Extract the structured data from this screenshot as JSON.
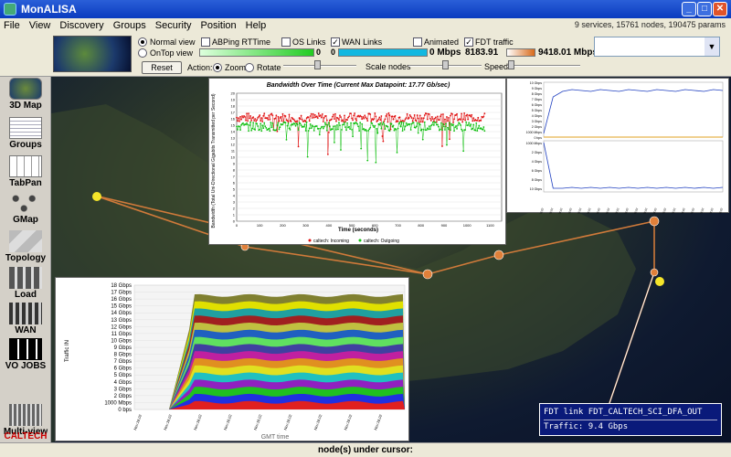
{
  "window": {
    "title": "MonALISA"
  },
  "menu": [
    "File",
    "View",
    "Discovery",
    "Groups",
    "Security",
    "Position",
    "Help"
  ],
  "status_summary": "9 services, 15761 nodes, 190475 params",
  "toolbar": {
    "normal_view": "Normal view",
    "ontop_view": "OnTop view",
    "reset": "Reset",
    "abping": "ABPing RTTime",
    "os_links": "OS Links",
    "wan_links": "WAN Links",
    "animated": "Animated",
    "fdt_traffic": "FDT traffic",
    "abping_val": "0",
    "os_val": "0",
    "wan_val": "0",
    "wan_rate": "0 Mbps",
    "fdt_min": "8183.91",
    "fdt_max": "9418.01 Mbps",
    "action": "Action:",
    "zoom": "Zoom",
    "rotate": "Rotate",
    "scale_nodes": "Scale nodes",
    "speed": "Speed",
    "wan_checked": "✓",
    "fdt_checked": "✓",
    "colors": {
      "abping": "#22cc22",
      "wan": "#12b8e0",
      "fdt_start": "#ffffff",
      "fdt_end": "#d86a1a"
    }
  },
  "sidebar": [
    {
      "label": "3D Map",
      "icon": "globe-icon"
    },
    {
      "label": "Groups",
      "icon": "groups-icon"
    },
    {
      "label": "TabPan",
      "icon": "table-icon"
    },
    {
      "label": "GMap",
      "icon": "graph-icon"
    },
    {
      "label": "Topology",
      "icon": "topology-icon"
    },
    {
      "label": "Load",
      "icon": "load-icon"
    },
    {
      "label": "WAN",
      "icon": "wan-icon"
    },
    {
      "label": "VO JOBS",
      "icon": "jobs-icon"
    },
    {
      "label": "Multi-view",
      "icon": "multiview-icon"
    }
  ],
  "logo": "CALTECH",
  "statusbar": "node(s) under cursor:",
  "tooltip": {
    "line1": "FDT link FDT_CALTECH_SCI_DFA_OUT",
    "line2": "Traffic: 9.4 Gbps"
  },
  "bw_title": "Bandwidth Over Time (Current Max Datapoint: 17.77 Gb/sec)",
  "bw_ylabel": "Bandwidth (Total Uni-Directional Gigabits Transmitted per Second)",
  "bw_xlabel": "Time (seconds)",
  "bw_legend": [
    "caltech: Incoming",
    "caltech: Outgoing"
  ],
  "stack_ylabel": "Traffic IN",
  "stack_xlabel": "GMT time",
  "chart_data": [
    {
      "type": "scatter",
      "title": "Bandwidth Over Time (Current Max Datapoint: 17.77 Gb/sec)",
      "xlabel": "Time (seconds)",
      "ylabel": "Bandwidth (Total Uni-Directional Gigabits Transmitted per Second)",
      "xticks": [
        0,
        100,
        200,
        300,
        400,
        500,
        600,
        700,
        800,
        900,
        1000,
        1100
      ],
      "yticks": [
        0,
        1,
        2,
        3,
        4,
        5,
        6,
        7,
        8,
        9,
        10,
        11,
        12,
        13,
        14,
        15,
        16,
        17,
        18,
        19,
        20
      ],
      "series": [
        {
          "name": "caltech: Incoming",
          "color": "#e01010",
          "typical": 16.2
        },
        {
          "name": "caltech: Outgoing",
          "color": "#10c010",
          "typical": 14.8
        }
      ]
    },
    {
      "type": "area",
      "ylabel": "Traffic IN",
      "xlabel": "GMT time",
      "yticks": [
        "0 bps",
        "1000 Mbps",
        "2 Gbps",
        "3 Gbps",
        "4 Gbps",
        "5 Gbps",
        "6 Gbps",
        "7 Gbps",
        "8 Gbps",
        "9 Gbps",
        "10 Gbps",
        "11 Gbps",
        "12 Gbps",
        "13 Gbps",
        "14 Gbps",
        "15 Gbps",
        "16 Gbps",
        "17 Gbps",
        "18 Gbps"
      ],
      "layers": 16,
      "peak_gbps": 16.5,
      "colors": [
        "#e02020",
        "#2030e0",
        "#20c020",
        "#9020c0",
        "#20c0c0",
        "#e0e020",
        "#e09020",
        "#c020a0",
        "#4040a0",
        "#60e060",
        "#2060c0",
        "#c0c040",
        "#a02020",
        "#20a0a0",
        "#e0e000",
        "#808030"
      ]
    },
    {
      "type": "line",
      "panels": [
        "Traffic IN",
        "Traffic OUT"
      ],
      "yticks_top": [
        "10 Gbps",
        "9 Gbps",
        "8 Gbps",
        "7 Gbps",
        "6 Gbps",
        "5 Gbps",
        "4 Gbps",
        "3 Gbps",
        "2 Gbps",
        "1000 Mbps",
        "0 bps"
      ],
      "yticks_bottom": [
        "1000 Mbps",
        "2 Gbps",
        "4 Gbps",
        "6 Gbps",
        "8 Gbps",
        "10 Gbps"
      ]
    }
  ]
}
